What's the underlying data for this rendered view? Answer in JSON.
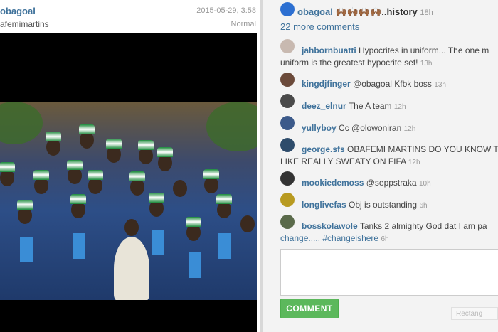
{
  "post": {
    "owner": "obagoal",
    "date": "2015-05-29, 3:58",
    "caption": "afemimartins",
    "filter": "Normal"
  },
  "comments_panel": {
    "header_user": "obagoal",
    "header_title": "🙌🏾🙌🏾🙌🏾🙌🏾..history",
    "header_time": "18h",
    "more_comments": "22 more comments",
    "comments": [
      {
        "user": "jahbornbuatti",
        "text": "Hypocrites in uniform... The one m",
        "cont": "uniform is the greatest hypocrite sef!",
        "time": "13h"
      },
      {
        "user": "kingdjfinger",
        "text": "@obagoal Kfbk boss",
        "time": "13h"
      },
      {
        "user": "deez_elnur",
        "text": "The A team",
        "time": "12h"
      },
      {
        "user": "yullyboy",
        "text": "Cc @olowoniran",
        "time": "12h"
      },
      {
        "user": "george.sfs",
        "text": "OBAFEMI MARTINS DO YOU KNOW T",
        "cont": "LIKE REALLY SWEATY ON FIFA",
        "time": "12h"
      },
      {
        "user": "mookiedemoss",
        "text": "@seppstraka",
        "time": "10h"
      },
      {
        "user": "longlivefas",
        "text": "Obj is outstanding",
        "time": "6h"
      },
      {
        "user": "bosskolawole",
        "text": "Tanks 2 almighty God dat I am pa",
        "cont": "change..... #changeishere",
        "time": "6h"
      }
    ],
    "comment_button": "COMMENT",
    "rect_hint": "Rectang"
  },
  "colors": {
    "link": "#3f729b",
    "button": "#5cb85c"
  }
}
